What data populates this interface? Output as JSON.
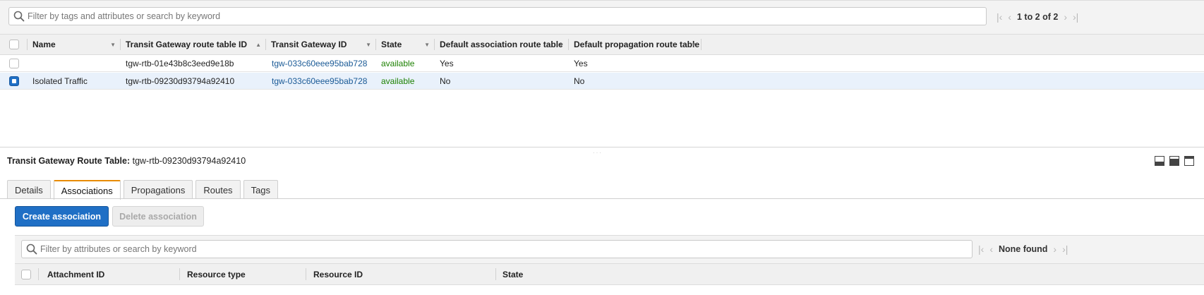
{
  "top": {
    "search_placeholder": "Filter by tags and attributes or search by keyword",
    "pager_text": "1 to 2 of 2"
  },
  "table": {
    "columns": [
      {
        "label": "Name",
        "sort": "▼"
      },
      {
        "label": "Transit Gateway route table ID",
        "sort": "▲"
      },
      {
        "label": "Transit Gateway ID",
        "sort": "▼"
      },
      {
        "label": "State",
        "sort": "▼"
      },
      {
        "label": "Default association route table",
        "sort": "▼"
      },
      {
        "label": "Default propagation route table",
        "sort": "▼"
      }
    ],
    "rows": [
      {
        "selected": false,
        "name": "",
        "rtb_id": "tgw-rtb-01e43b8c3eed9e18b",
        "tgw_id": "tgw-033c60eee95bab728",
        "state": "available",
        "assoc": "Yes",
        "prop": "Yes"
      },
      {
        "selected": true,
        "name": "Isolated Traffic",
        "rtb_id": "tgw-rtb-09230d93794a92410",
        "tgw_id": "tgw-033c60eee95bab728",
        "state": "available",
        "assoc": "No",
        "prop": "No"
      }
    ]
  },
  "detail": {
    "title_label": "Transit Gateway Route Table:",
    "title_value": "tgw-rtb-09230d93794a92410",
    "tabs": [
      "Details",
      "Associations",
      "Propagations",
      "Routes",
      "Tags"
    ],
    "active_tab": "Associations",
    "create_button": "Create association",
    "delete_button": "Delete association",
    "search_placeholder": "Filter by attributes or search by keyword",
    "pager_text": "None found",
    "columns": [
      "Attachment ID",
      "Resource type",
      "Resource ID",
      "State"
    ]
  },
  "colors": {
    "primary": "#1f6fc5",
    "link": "#1a5a96",
    "status_ok": "#1d8102",
    "active_tab_accent": "#e88b00",
    "selected_row": "#e9f1fb"
  },
  "icons": [
    "search-icon",
    "first-page-icon",
    "prev-page-icon",
    "next-page-icon",
    "last-page-icon",
    "sort-icon",
    "layout-bottom-icon",
    "layout-split-icon",
    "layout-full-icon"
  ]
}
